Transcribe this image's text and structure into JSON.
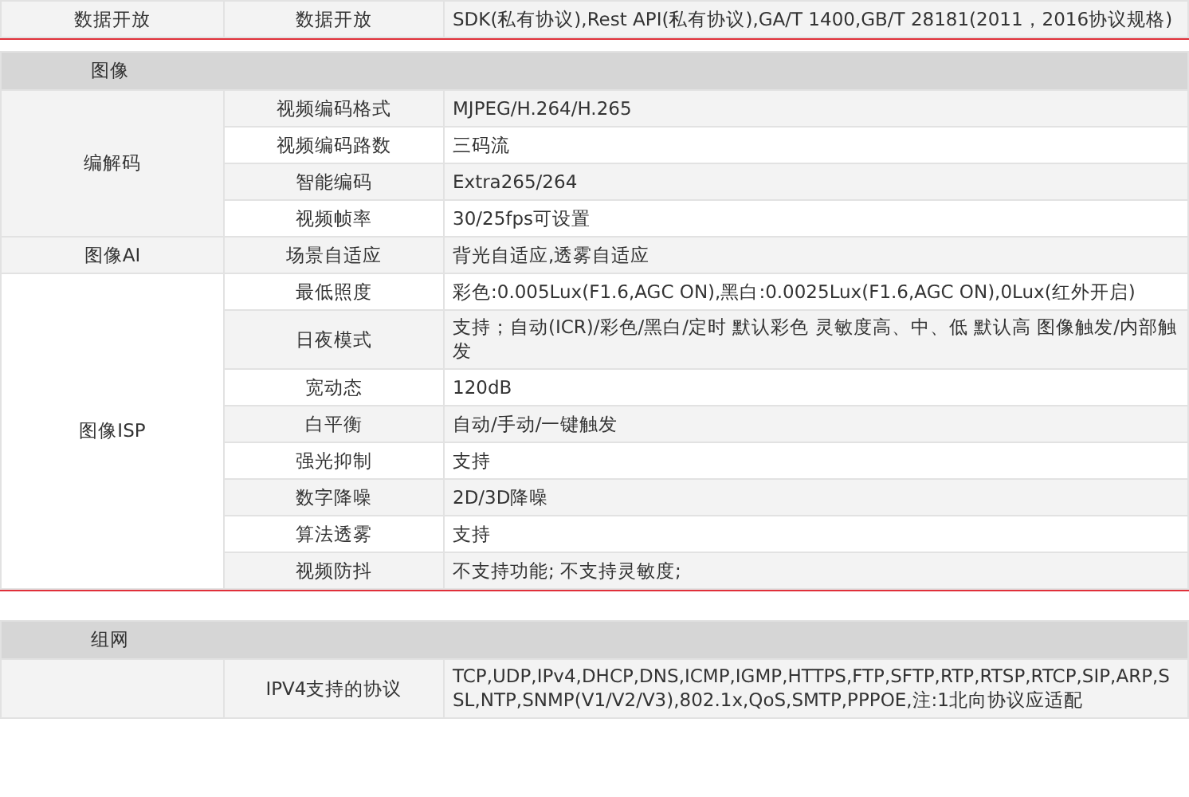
{
  "top_row": {
    "category": "数据开放",
    "item": "数据开放",
    "value": "SDK(私有协议),Rest API(私有协议),GA/T 1400,GB/T 28181(2011，2016协议规格)"
  },
  "sections": [
    {
      "title": "图像",
      "groups": [
        {
          "name": "编解码",
          "rows": [
            {
              "item": "视频编码格式",
              "value": "MJPEG/H.264/H.265"
            },
            {
              "item": "视频编码路数",
              "value": "三码流"
            },
            {
              "item": "智能编码",
              "value": "Extra265/264"
            },
            {
              "item": "视频帧率",
              "value": "30/25fps可设置"
            }
          ]
        },
        {
          "name": "图像AI",
          "rows": [
            {
              "item": "场景自适应",
              "value": "背光自适应,透雾自适应"
            }
          ]
        },
        {
          "name": "图像ISP",
          "rows": [
            {
              "item": "最低照度",
              "value": "彩色:0.005Lux(F1.6,AGC ON),黑白:0.0025Lux(F1.6,AGC ON),0Lux(红外开启)"
            },
            {
              "item": "日夜模式",
              "value": "支持；自动(ICR)/彩色/黑白/定时 默认彩色 灵敏度高、中、低 默认高 图像触发/内部触发"
            },
            {
              "item": "宽动态",
              "value": "120dB"
            },
            {
              "item": "白平衡",
              "value": "自动/手动/一键触发"
            },
            {
              "item": "强光抑制",
              "value": "支持"
            },
            {
              "item": "数字降噪",
              "value": "2D/3D降噪"
            },
            {
              "item": "算法透雾",
              "value": "支持"
            },
            {
              "item": "视频防抖",
              "value": "不支持功能; 不支持灵敏度;"
            }
          ]
        }
      ]
    },
    {
      "title": "组网",
      "groups": [
        {
          "rows": [
            {
              "item": "IPV4支持的协议",
              "value": "TCP,UDP,IPv4,DHCP,DNS,ICMP,IGMP,HTTPS,FTP,SFTP,RTP,RTSP,RTCP,SIP,ARP,SSL,NTP,SNMP(V1/V2/V3),802.1x,QoS,SMTP,PPPOE,注:1北向协议应适配"
            }
          ]
        }
      ]
    }
  ]
}
